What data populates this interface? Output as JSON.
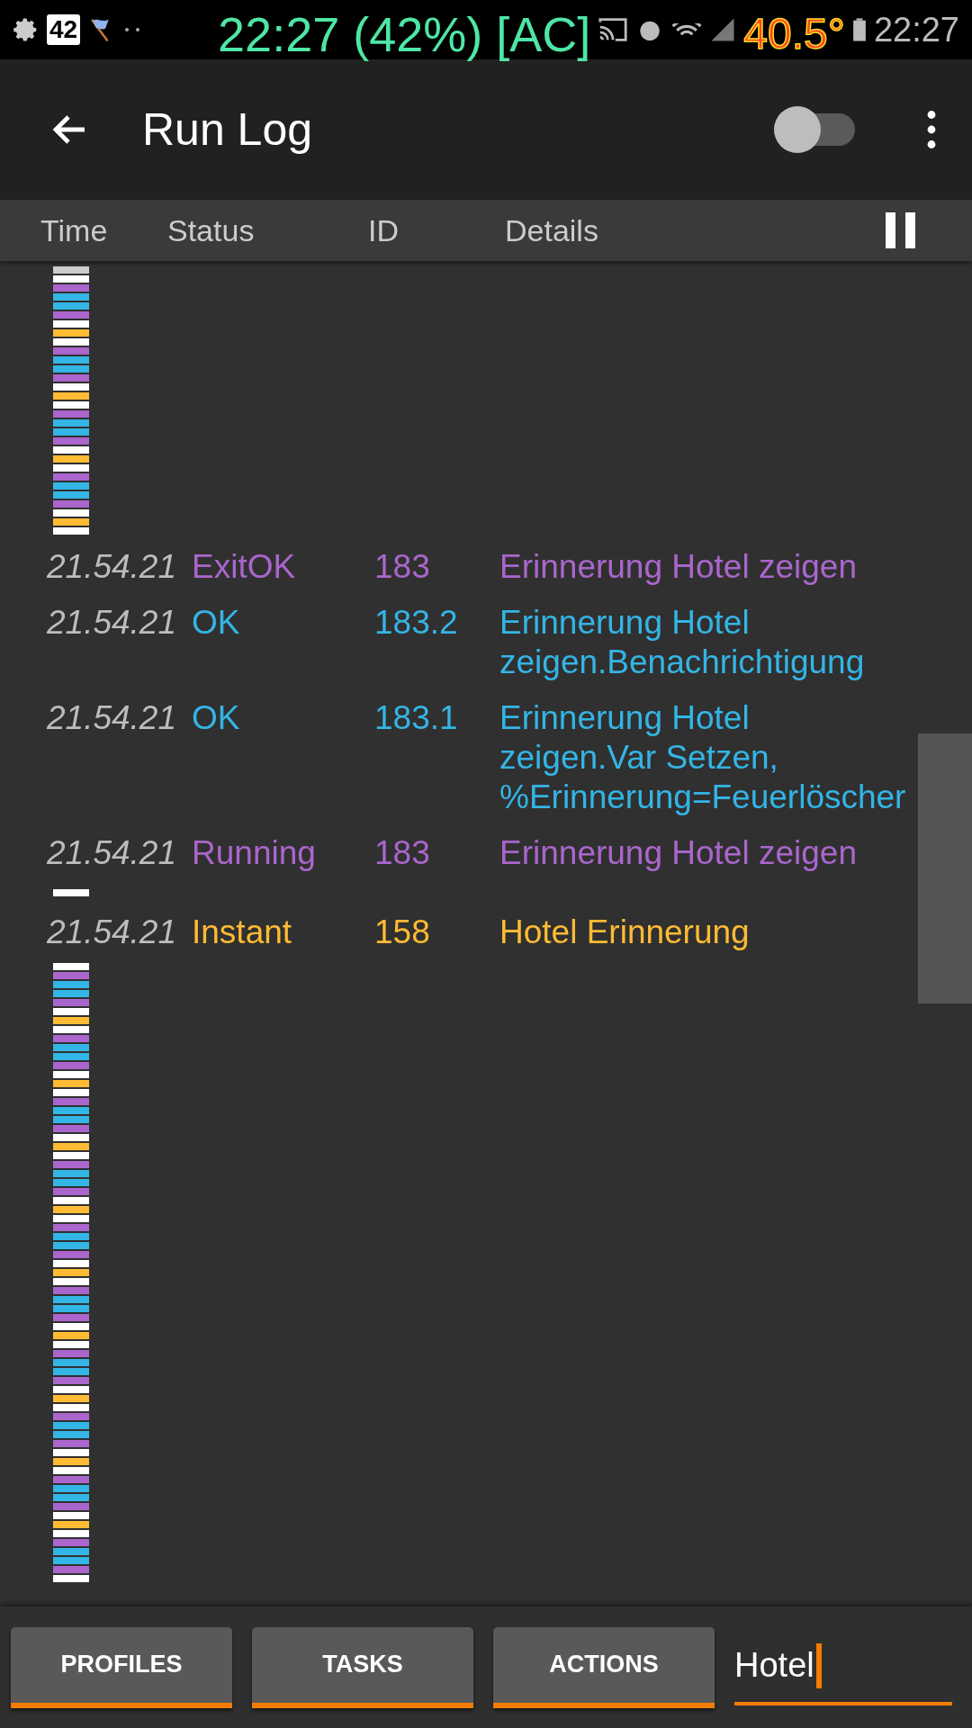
{
  "status_bar": {
    "notification_count": "42",
    "clock": "22:27"
  },
  "overlay": {
    "battery_text": "22:27 (42%) [AC]",
    "temperature": "40.5°"
  },
  "app_bar": {
    "title": "Run Log",
    "switch": {
      "on": false
    }
  },
  "columns": [
    "Time",
    "Status",
    "ID",
    "Details"
  ],
  "paused": true,
  "rows": [
    {
      "time": "21.54.21",
      "status": "ExitOK",
      "id": "183",
      "details": "Erinnerung Hotel zeigen",
      "color": "#aa66cc"
    },
    {
      "time": "21.54.21",
      "status": "OK",
      "id": "183.2",
      "details": "Erinnerung Hotel zeigen.Benachrichtigung",
      "color": "#33b5e5"
    },
    {
      "time": "21.54.21",
      "status": "OK",
      "id": "183.1",
      "details": "Erinnerung Hotel zeigen.Var Setzen, %Erinnerung=Feuerlöscher",
      "color": "#33b5e5"
    },
    {
      "time": "21.54.21",
      "status": "Running",
      "id": "183",
      "details": "Erinnerung Hotel zeigen",
      "color": "#aa66cc"
    },
    {
      "time": "21.54.21",
      "status": "Instant",
      "id": "158",
      "details": "Hotel Erinnerung",
      "color": "#ffbb33"
    }
  ],
  "bottom_tabs": [
    {
      "label": "PROFILES"
    },
    {
      "label": "TASKS"
    },
    {
      "label": "ACTIONS"
    }
  ],
  "filter": {
    "value": "Hotel"
  }
}
